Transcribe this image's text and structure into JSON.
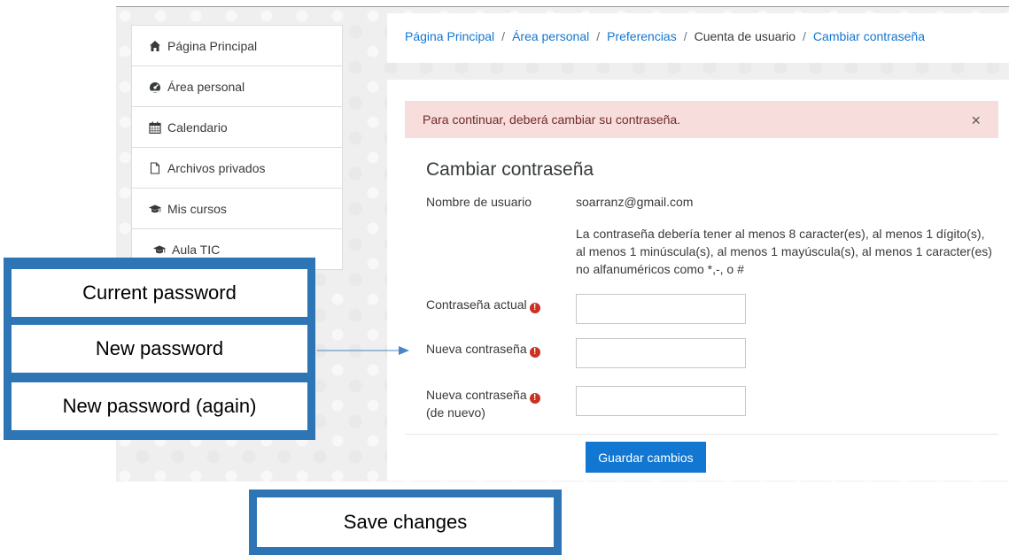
{
  "sidebar": {
    "items": [
      {
        "label": "Página Principal",
        "icon": "home-icon"
      },
      {
        "label": "Área personal",
        "icon": "dashboard-icon"
      },
      {
        "label": "Calendario",
        "icon": "calendar-icon"
      },
      {
        "label": "Archivos privados",
        "icon": "file-icon"
      },
      {
        "label": "Mis cursos",
        "icon": "graduation-cap-icon"
      },
      {
        "label": "Aula TIC",
        "icon": "graduation-cap-icon"
      }
    ]
  },
  "breadcrumb": {
    "items": [
      "Página Principal",
      "Área personal",
      "Preferencias",
      "Cuenta de usuario",
      "Cambiar contraseña"
    ],
    "separator": "/"
  },
  "alert": {
    "message": "Para continuar, deberá cambiar su contraseña.",
    "close": "×"
  },
  "form": {
    "title": "Cambiar contraseña",
    "username_label": "Nombre de usuario",
    "username_value": "soarranz@gmail.com",
    "rules": "La contraseña debería tener al menos 8 caracter(es), al menos 1 dígito(s), al menos 1 minúscula(s), al menos 1 mayúscula(s), al menos 1 caracter(es) no alfanuméricos como *,-, o #",
    "current_label": "Contraseña actual",
    "new_label": "Nueva contraseña",
    "new_again_label_line1": "Nueva contraseña",
    "new_again_label_line2": "(de nuevo)",
    "required_icon": "!",
    "current_value": "",
    "new_value": "",
    "new_again_value": "",
    "save_label": "Guardar cambios"
  },
  "annotations": {
    "current": "Current password",
    "new": "New password",
    "new_again": "New password (again)",
    "save": "Save changes"
  },
  "colors": {
    "link": "#1177d1",
    "button": "#1177d1",
    "alert_bg": "#f7dddc",
    "alert_text": "#712b29",
    "required": "#ca3120",
    "annotation_border": "#2e75b6"
  }
}
